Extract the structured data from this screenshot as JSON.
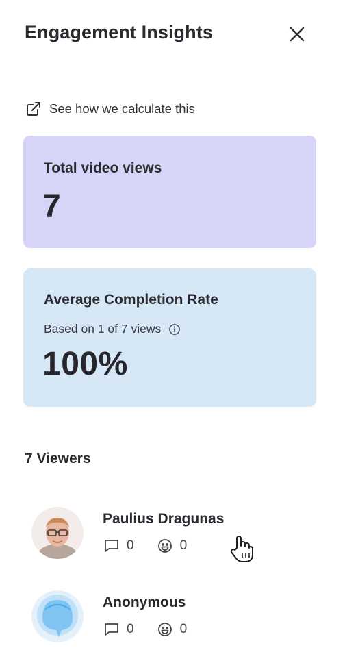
{
  "panel": {
    "title": "Engagement Insights",
    "close_icon": "close-icon"
  },
  "calc_link": {
    "label": "See how we calculate this",
    "icon": "external-link-icon"
  },
  "total_views": {
    "label": "Total video views",
    "value": "7",
    "color": "#d6d4f7"
  },
  "completion": {
    "label": "Average Completion Rate",
    "sub": "Based on 1 of 7 views",
    "value": "100%",
    "info_icon": "info-icon",
    "color": "#d6e7f6"
  },
  "viewers": {
    "heading": "7 Viewers",
    "list": [
      {
        "name": "Paulius Dragunas",
        "comments": "0",
        "reactions": "0",
        "avatar": "photo"
      },
      {
        "name": "Anonymous",
        "comments": "0",
        "reactions": "0",
        "avatar": "anonymous-blue"
      }
    ]
  }
}
